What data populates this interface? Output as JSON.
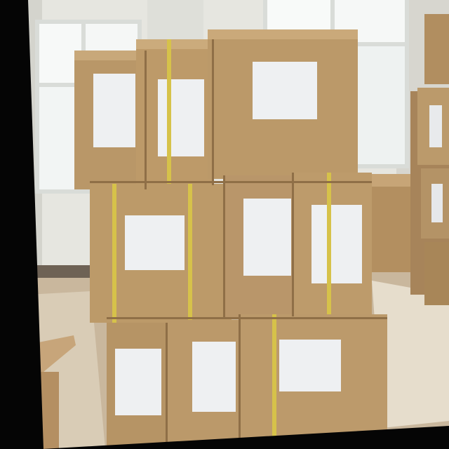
{
  "scene": {
    "colors": {
      "wall": "#e6e6e0",
      "wall_shadow": "#cfcfc8",
      "floor": "#c9b79d",
      "floor_shine": "#efe8da",
      "window_glass": "#f7f9f8",
      "window_frame": "#d9dcd8",
      "carton": "#b99768",
      "carton_dark": "#8f6f47",
      "carton_light": "#c8a87a",
      "label": "#eef0f2",
      "strap": "#d6c24a",
      "black_border": "#050505"
    },
    "objects": [
      "left-window",
      "right-window",
      "carton-stack-center",
      "carton-stack-right",
      "low-carton-back-right",
      "table-left",
      "pallet-left"
    ]
  }
}
